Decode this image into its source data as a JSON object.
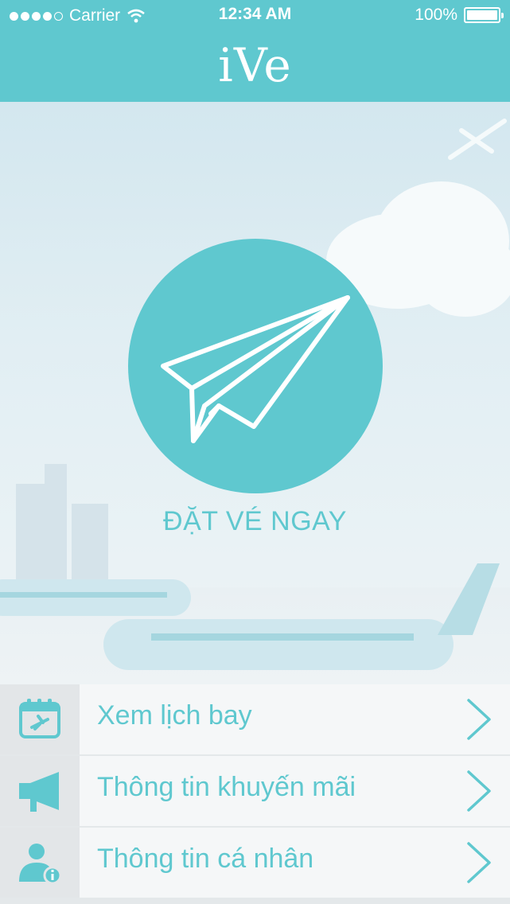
{
  "status_bar": {
    "carrier": "Carrier",
    "time": "12:34 AM",
    "battery": "100%"
  },
  "app": {
    "title": "iVe",
    "accent_color": "#5fc8cf"
  },
  "hero": {
    "cta_label": "ĐẶT VÉ NGAY",
    "cta_icon": "paper-plane-icon"
  },
  "menu": {
    "items": [
      {
        "label": "Xem lịch bay",
        "icon": "calendar-flight-icon"
      },
      {
        "label": "Thông tin khuyến mãi",
        "icon": "megaphone-icon"
      },
      {
        "label": "Thông tin cá nhân",
        "icon": "user-info-icon"
      }
    ]
  }
}
